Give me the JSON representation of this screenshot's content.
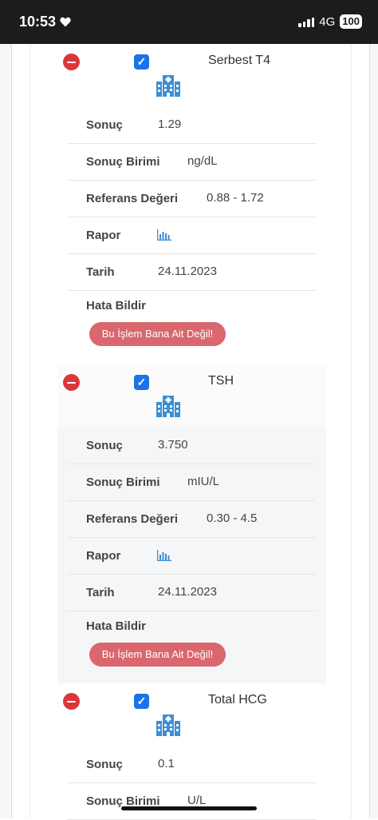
{
  "status": {
    "time": "10:53",
    "network": "4G",
    "battery": "100"
  },
  "tests": [
    {
      "name": "Serbest T4",
      "sonuc_label": "Sonuç",
      "sonuc": "1.29",
      "birim_label": "Sonuç Birimi",
      "birim": "ng/dL",
      "referans_label": "Referans Değeri",
      "referans": "0.88 - 1.72",
      "rapor_label": "Rapor",
      "tarih_label": "Tarih",
      "tarih": "24.11.2023",
      "hata_label": "Hata Bildir",
      "button": "Bu İşlem Bana Ait Değil!"
    },
    {
      "name": "TSH",
      "sonuc_label": "Sonuç",
      "sonuc": "3.750",
      "birim_label": "Sonuç Birimi",
      "birim": "mIU/L",
      "referans_label": "Referans Değeri",
      "referans": "0.30 - 4.5",
      "rapor_label": "Rapor",
      "tarih_label": "Tarih",
      "tarih": "24.11.2023",
      "hata_label": "Hata Bildir",
      "button": "Bu İşlem Bana Ait Değil!"
    },
    {
      "name": "Total HCG",
      "sonuc_label": "Sonuç",
      "sonuc": "0.1",
      "birim_label": "Sonuç Birimi",
      "birim": "U/L"
    }
  ],
  "colors": {
    "remove": "#d9383a",
    "checkbox": "#1a73e8",
    "button": "#d9676d",
    "icon": "#3a8fd6"
  },
  "icons": {
    "remove": "minus-circle-icon",
    "select": "checkbox-checked-icon",
    "hospital": "hospital-building-icon",
    "report": "bar-chart-icon"
  }
}
